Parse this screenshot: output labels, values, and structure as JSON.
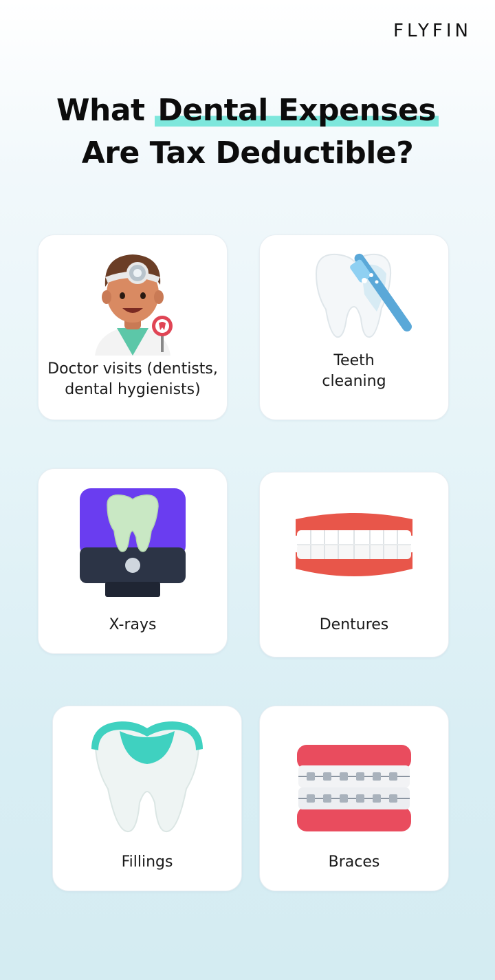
{
  "brand": {
    "logo_text": "FLYFIN"
  },
  "headline": {
    "part1": "What ",
    "highlight": "Dental Expenses",
    "line2": "Are Tax Deductible?"
  },
  "cards": [
    {
      "label_line1": "Doctor visits (dentists,",
      "label_line2": "dental hygienists)",
      "icon": "dentist-icon"
    },
    {
      "label_line1": "Teeth",
      "label_line2": "cleaning",
      "icon": "tooth-brush-icon"
    },
    {
      "label_line1": "X-rays",
      "icon": "xray-machine-icon"
    },
    {
      "label_line1": "Dentures",
      "icon": "dentures-icon"
    },
    {
      "label_line1": "Fillings",
      "icon": "filled-tooth-icon"
    },
    {
      "label_line1": "Braces",
      "icon": "braces-icon"
    }
  ],
  "colors": {
    "highlight": "#7ee7dc",
    "accent_purple": "#6a3df0",
    "gum_red": "#e8564a",
    "filling_teal": "#3fd1c0"
  }
}
